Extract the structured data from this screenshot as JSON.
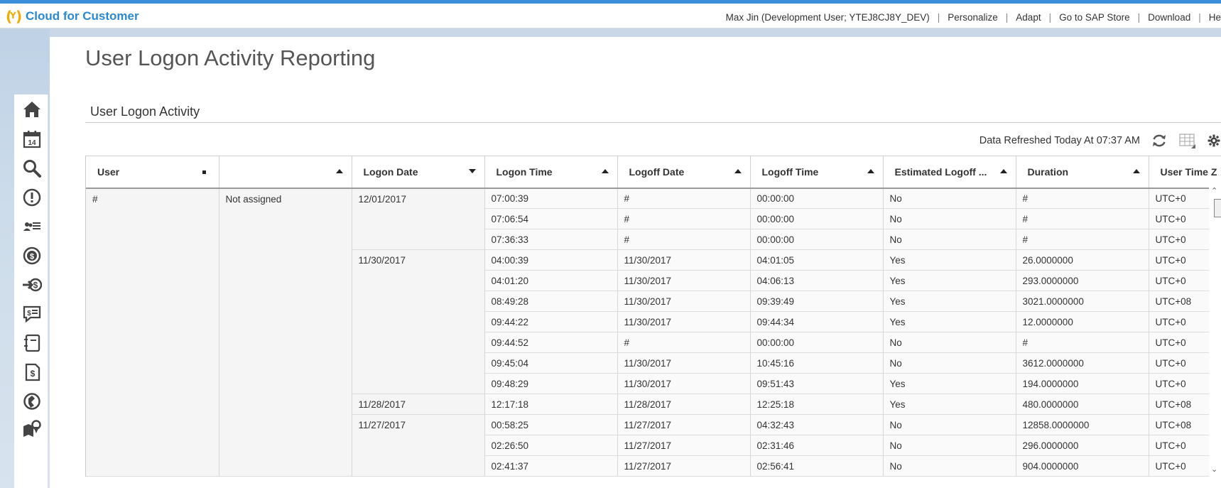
{
  "shell": {
    "app_name": "Cloud for Customer",
    "user": "Max Jin (Development User; YTEJ8CJ8Y_DEV)",
    "links": [
      "Personalize",
      "Adapt",
      "Go to SAP Store",
      "Download",
      "He"
    ]
  },
  "page": {
    "title": "User Logon Activity Reporting",
    "section_title": "User Logon Activity",
    "refresh_text": "Data Refreshed Today At 07:37 AM"
  },
  "nav_icons": [
    "home-icon",
    "calendar-icon",
    "search-icon",
    "alert-icon",
    "people-list-icon",
    "money-icon",
    "money-in-icon",
    "chat-money-icon",
    "notebook-icon",
    "document-money-icon",
    "globe-refresh-icon",
    "map-pin-icon"
  ],
  "table": {
    "columns": [
      {
        "label": "User",
        "sort": "dot"
      },
      {
        "label": "",
        "sort": "up"
      },
      {
        "label": "Logon Date",
        "sort": "down"
      },
      {
        "label": "Logon Time",
        "sort": "up"
      },
      {
        "label": "Logoff Date",
        "sort": "up"
      },
      {
        "label": "Logoff Time",
        "sort": "up"
      },
      {
        "label": "Estimated Logoff ...",
        "sort": "up"
      },
      {
        "label": "Duration",
        "sort": "up"
      },
      {
        "label": "User Time Z",
        "sort": "none"
      }
    ],
    "group_user": "#",
    "group_user_name": "Not assigned",
    "date_groups": [
      {
        "date": "12/01/2017",
        "rows": [
          [
            "07:00:39",
            "#",
            "00:00:00",
            "No",
            "#",
            "UTC+0"
          ],
          [
            "07:06:54",
            "#",
            "00:00:00",
            "No",
            "#",
            "UTC+0"
          ],
          [
            "07:36:33",
            "#",
            "00:00:00",
            "No",
            "#",
            "UTC+0"
          ]
        ]
      },
      {
        "date": "11/30/2017",
        "rows": [
          [
            "04:00:39",
            "11/30/2017",
            "04:01:05",
            "Yes",
            "26.0000000",
            "UTC+0"
          ],
          [
            "04:01:20",
            "11/30/2017",
            "04:06:13",
            "Yes",
            "293.0000000",
            "UTC+0"
          ],
          [
            "08:49:28",
            "11/30/2017",
            "09:39:49",
            "Yes",
            "3021.0000000",
            "UTC+08"
          ],
          [
            "09:44:22",
            "11/30/2017",
            "09:44:34",
            "Yes",
            "12.0000000",
            "UTC+0"
          ],
          [
            "09:44:52",
            "#",
            "00:00:00",
            "No",
            "#",
            "UTC+0"
          ],
          [
            "09:45:04",
            "11/30/2017",
            "10:45:16",
            "No",
            "3612.0000000",
            "UTC+0"
          ],
          [
            "09:48:29",
            "11/30/2017",
            "09:51:43",
            "Yes",
            "194.0000000",
            "UTC+0"
          ]
        ]
      },
      {
        "date": "11/28/2017",
        "rows": [
          [
            "12:17:18",
            "11/28/2017",
            "12:25:18",
            "Yes",
            "480.0000000",
            "UTC+08"
          ]
        ]
      },
      {
        "date": "11/27/2017",
        "rows": [
          [
            "00:58:25",
            "11/27/2017",
            "04:32:43",
            "No",
            "12858.0000000",
            "UTC+08"
          ],
          [
            "02:26:50",
            "11/27/2017",
            "02:31:46",
            "No",
            "296.0000000",
            "UTC+0"
          ],
          [
            "02:41:37",
            "11/27/2017",
            "02:56:41",
            "No",
            "904.0000000",
            "UTC+0"
          ]
        ]
      }
    ]
  }
}
